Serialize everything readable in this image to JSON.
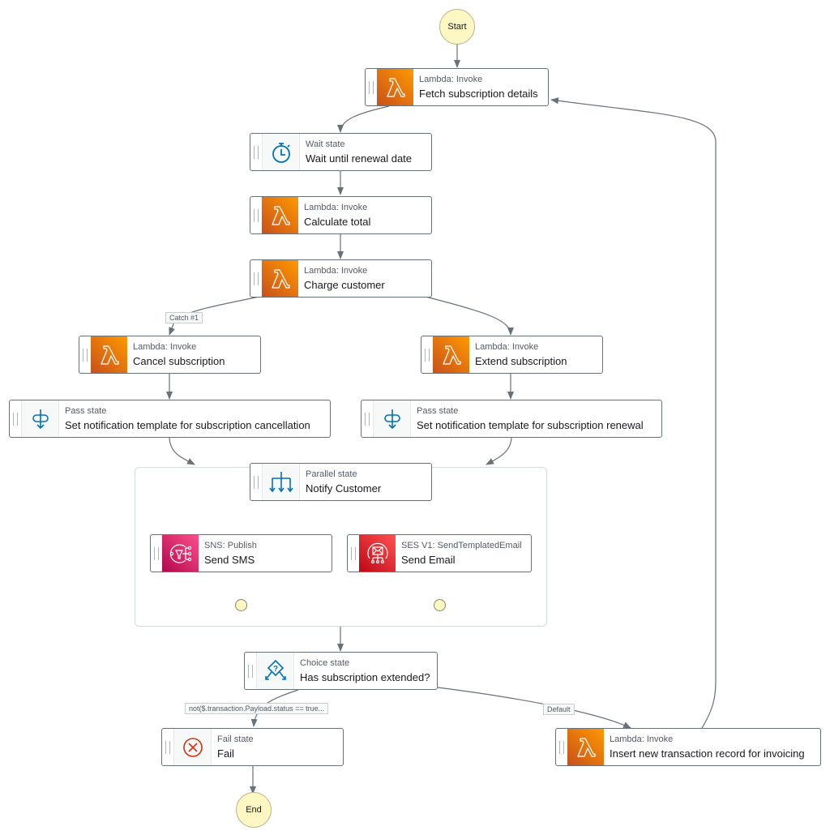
{
  "start_label": "Start",
  "end_label": "End",
  "colors": {
    "lambda": "#ff9900",
    "sns": "#e7157b",
    "ses": "#dd344c",
    "flow_icon": "#0073bb",
    "fail_icon": "#d13212",
    "edge": "#687078"
  },
  "states": {
    "fetch": {
      "type": "Lambda: Invoke",
      "name": "Fetch subscription details",
      "icon": "lambda-icon"
    },
    "wait": {
      "type": "Wait state",
      "name": "Wait until renewal date",
      "icon": "stopwatch-icon"
    },
    "calc": {
      "type": "Lambda: Invoke",
      "name": "Calculate total",
      "icon": "lambda-icon"
    },
    "charge": {
      "type": "Lambda: Invoke",
      "name": "Charge customer",
      "icon": "lambda-icon"
    },
    "cancel": {
      "type": "Lambda: Invoke",
      "name": "Cancel subscription",
      "icon": "lambda-icon"
    },
    "extend": {
      "type": "Lambda: Invoke",
      "name": "Extend subscription",
      "icon": "lambda-icon"
    },
    "pass_cancel": {
      "type": "Pass state",
      "name": "Set notification template for subscription cancellation",
      "icon": "pass-icon"
    },
    "pass_renew": {
      "type": "Pass state",
      "name": "Set notification template for subscription renewal",
      "icon": "pass-icon"
    },
    "parallel": {
      "type": "Parallel state",
      "name": "Notify Customer",
      "icon": "parallel-icon"
    },
    "sms": {
      "type": "SNS: Publish",
      "name": "Send SMS",
      "icon": "sns-icon"
    },
    "email": {
      "type": "SES V1: SendTemplatedEmail",
      "name": "Send Email",
      "icon": "ses-icon"
    },
    "choice": {
      "type": "Choice state",
      "name": "Has subscription extended?",
      "icon": "choice-icon"
    },
    "fail": {
      "type": "Fail state",
      "name": "Fail",
      "icon": "fail-icon"
    },
    "insert": {
      "type": "Lambda: Invoke",
      "name": "Insert new transaction record for invoicing",
      "icon": "lambda-icon"
    }
  },
  "edge_labels": {
    "catch": "Catch #1",
    "choice_rule": "not($.transaction.Payload.status == true...",
    "default": "Default"
  }
}
